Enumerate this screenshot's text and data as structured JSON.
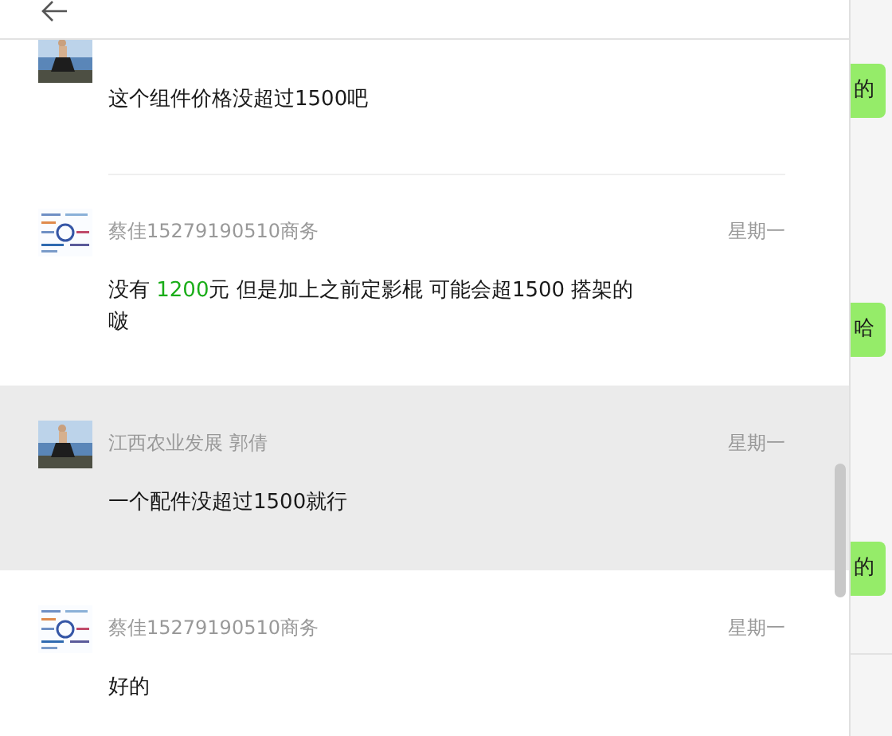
{
  "messages": [
    {
      "text": [
        {
          "t": "这个组件价格没超过1500吧",
          "highlight": false
        }
      ],
      "selected": false
    },
    {
      "name": "蔡佳15279190510商务",
      "time": "星期一",
      "text": [
        {
          "t": "没有 ",
          "highlight": false
        },
        {
          "t": "1200",
          "highlight": true
        },
        {
          "t": "元 但是加上之前定影棍 可能会超1500 搭架的啵",
          "highlight": false
        }
      ],
      "selected": false
    },
    {
      "name": "江西农业发展 郭倩",
      "time": "星期一",
      "text": [
        {
          "t": "一个配件没超过1500就行",
          "highlight": false
        }
      ],
      "selected": true
    },
    {
      "name": "蔡佳15279190510商务",
      "time": "星期一",
      "text": [
        {
          "t": "好的",
          "highlight": false
        }
      ],
      "selected": false
    }
  ],
  "side_bubbles": [
    "的",
    "哈",
    "的"
  ]
}
